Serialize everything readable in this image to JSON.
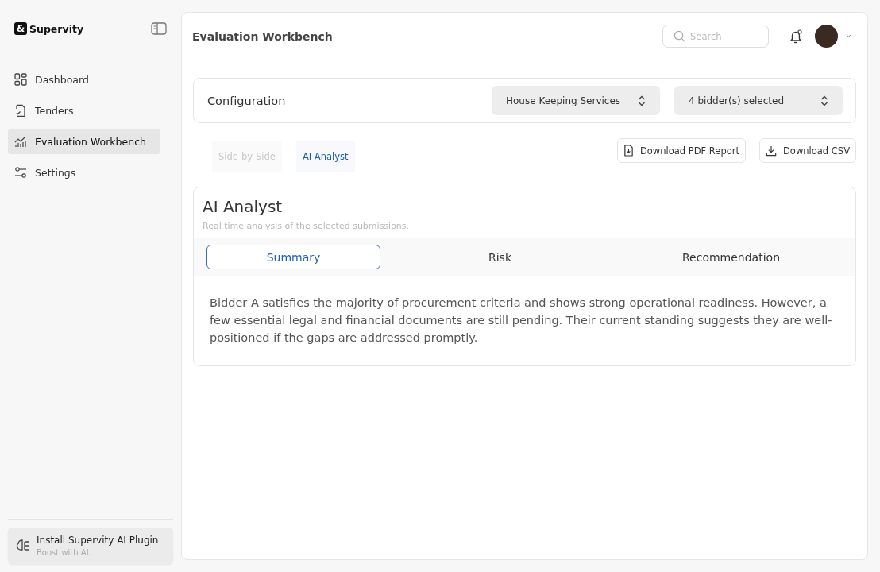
{
  "brand": {
    "name": "Supervity",
    "mark": "&"
  },
  "sidebar": {
    "items": [
      {
        "label": "Dashboard",
        "selected": false
      },
      {
        "label": "Tenders",
        "selected": false
      },
      {
        "label": "Evaluation Workbench",
        "selected": true
      },
      {
        "label": "Settings",
        "selected": false
      }
    ],
    "promo": {
      "title": "Install Supervity AI Plugin",
      "subtitle": "Boost with AI."
    }
  },
  "header": {
    "title": "Evaluation Workbench",
    "search": {
      "placeholder": "Search"
    }
  },
  "configuration": {
    "title": "Configuration",
    "selects": [
      "House Keeping Services",
      "4 bidder(s) selected"
    ]
  },
  "view_tabs": [
    {
      "label": "Side-by-Side",
      "selected": false
    },
    {
      "label": "AI Analyst",
      "selected": true
    }
  ],
  "actions": [
    {
      "label": "Download PDF Report"
    },
    {
      "label": "Download CSV"
    }
  ],
  "analyst": {
    "title": "AI Analyst",
    "subtitle": "Real time analysis of the selected submissions.",
    "tabs": [
      {
        "label": "Summary",
        "selected": true
      },
      {
        "label": "Risk",
        "selected": false
      },
      {
        "label": "Recommendation",
        "selected": false
      }
    ],
    "text": "Bidder A satisfies the majority of procurement criteria and shows strong operational readiness. However, a few essential legal and financial documents are still pending. Their current standing suggests they are well-positioned if the gaps are addressed promptly."
  }
}
